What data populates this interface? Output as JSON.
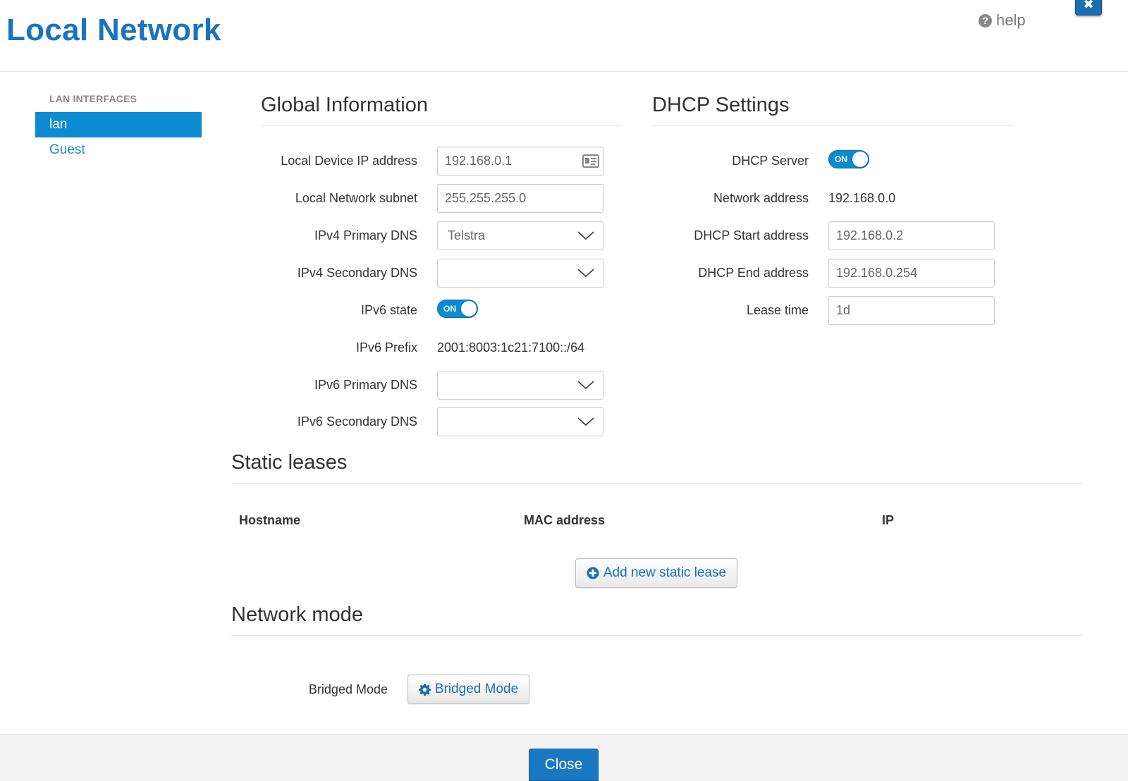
{
  "header": {
    "title": "Local Network",
    "help_label": "help"
  },
  "sidebar": {
    "heading": "LAN INTERFACES",
    "items": [
      {
        "label": "lan",
        "active": true
      },
      {
        "label": "Guest",
        "active": false
      }
    ]
  },
  "global": {
    "title": "Global Information",
    "local_ip_label": "Local Device IP address",
    "local_ip_value": "192.168.0.1",
    "subnet_label": "Local Network subnet",
    "subnet_value": "255.255.255.0",
    "ipv4_primary_label": "IPv4 Primary DNS",
    "ipv4_primary_value": "Telstra",
    "ipv4_secondary_label": "IPv4 Secondary DNS",
    "ipv4_secondary_value": "",
    "ipv6_state_label": "IPv6 state",
    "ipv6_state_value": "ON",
    "ipv6_prefix_label": "IPv6 Prefix",
    "ipv6_prefix_value": "2001:8003:1c21:7100::/64",
    "ipv6_primary_label": "IPv6 Primary DNS",
    "ipv6_primary_value": "",
    "ipv6_secondary_label": "IPv6 Secondary DNS",
    "ipv6_secondary_value": ""
  },
  "dhcp": {
    "title": "DHCP Settings",
    "server_label": "DHCP Server",
    "server_value": "ON",
    "network_label": "Network address",
    "network_value": "192.168.0.0",
    "start_label": "DHCP Start address",
    "start_value": "192.168.0.2",
    "end_label": "DHCP End address",
    "end_value": "192.168.0.254",
    "lease_label": "Lease time",
    "lease_value": "1d"
  },
  "static_leases": {
    "title": "Static leases",
    "columns": [
      "Hostname",
      "MAC address",
      "IP"
    ],
    "add_button": "Add new static lease"
  },
  "network_mode": {
    "title": "Network mode",
    "bridged_label": "Bridged Mode",
    "bridged_button": "Bridged Mode"
  },
  "footer": {
    "close_label": "Close"
  },
  "colors": {
    "accent": "#0b8bd1",
    "title_blue": "#1a73c0"
  }
}
